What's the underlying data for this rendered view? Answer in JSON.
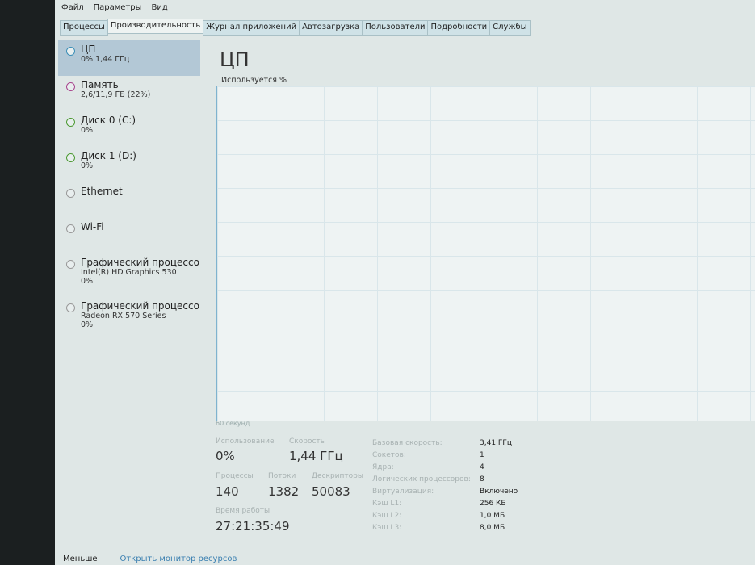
{
  "menu": [
    "Файл",
    "Параметры",
    "Вид"
  ],
  "tabs": [
    "Процессы",
    "Производительность",
    "Журнал приложений",
    "Автозагрузка",
    "Пользователи",
    "Подробности",
    "Службы"
  ],
  "sidebar": [
    {
      "name": "ЦП",
      "sub": "0% 1,44 ГГц",
      "color": "#3c8fb8"
    },
    {
      "name": "Память",
      "sub": "2,6/11,9 ГБ (22%)",
      "color": "#a8458e"
    },
    {
      "name": "Диск 0 (C:)",
      "sub": "0%",
      "color": "#4c9a32"
    },
    {
      "name": "Диск 1 (D:)",
      "sub": "0%",
      "color": "#4c9a32"
    },
    {
      "name": "Ethernet",
      "sub": "",
      "color": "#999999"
    },
    {
      "name": "Wi-Fi",
      "sub": "",
      "color": "#999999"
    },
    {
      "name": "Графический процессор",
      "sub": "Intel(R) HD Graphics 530",
      "sub2": "0%",
      "color": "#999999"
    },
    {
      "name": "Графический процессор",
      "sub": "Radeon RX 570 Series",
      "sub2": "0%",
      "color": "#999999"
    }
  ],
  "main": {
    "title": "ЦП",
    "graph_label": "Используется %",
    "seconds": "60 секунд",
    "usage_pct": 0,
    "stats": {
      "usage_label": "Использование",
      "usage": "0%",
      "speed_label": "Скорость",
      "speed": "1,44 ГГц",
      "proc_label": "Процессы",
      "proc": "140",
      "threads_label": "Потоки",
      "threads": "1382",
      "handles_label": "Дескрипторы",
      "handles": "50083",
      "uptime_label": "Время работы",
      "uptime": "27:21:35:49"
    },
    "details": [
      [
        "Базовая скорость:",
        "3,41 ГГц"
      ],
      [
        "Сокетов:",
        "1"
      ],
      [
        "Ядра:",
        "4"
      ],
      [
        "Логических процессоров:",
        "8"
      ],
      [
        "Виртуализация:",
        "Включено"
      ],
      [
        "Кэш L1:",
        "256 КБ"
      ],
      [
        "Кэш L2:",
        "1,0 МБ"
      ],
      [
        "Кэш L3:",
        "8,0 МБ"
      ]
    ]
  },
  "footer": {
    "less": "Меньше",
    "monitor": "Открыть монитор ресурсов"
  }
}
